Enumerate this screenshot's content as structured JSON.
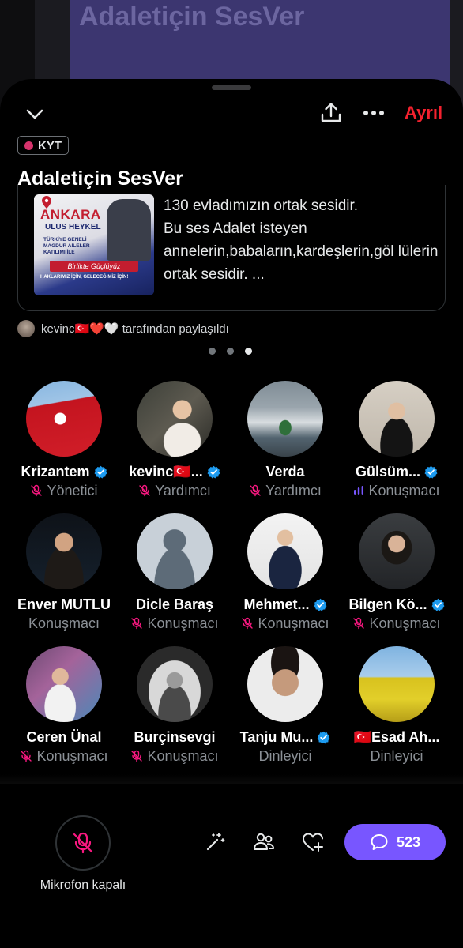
{
  "background": {
    "title": "Adaletiçin SesVer"
  },
  "header": {
    "leave_label": "Ayrıl",
    "badge": "KYT",
    "title": "Adaletiçin SesVer"
  },
  "pinned_post": {
    "text": "130 evladımızın ortak sesidir.\nBu ses Adalet isteyen annelerin,babaların,kardeşlerin,göl lülerin ortak sesidir. ...",
    "poster": {
      "city": "ANKARA",
      "place": "ULUS HEYKEL",
      "line": "TÜRKİYE GENELİ MAĞDUR AİLELER KATILIMI İLE",
      "slogan": "Birlikte Güçlüyüz",
      "footer": "HAKLARIMIZ İÇİN, GELECEĞİMİZ İÇİN!"
    },
    "shared_by": "kevinc🇹🇷❤️🤍 tarafından paylaşıldı"
  },
  "pager": {
    "count": 3,
    "active": 2
  },
  "participants": [
    {
      "name": "Krizantem",
      "verified": true,
      "role": "Yönetici",
      "status": "muted",
      "avatar": "flag"
    },
    {
      "name": "kevinc🇹🇷...",
      "verified": true,
      "role": "Yardımcı",
      "status": "muted",
      "avatar": "photo-woman"
    },
    {
      "name": "Verda",
      "verified": false,
      "role": "Yardımcı",
      "status": "muted",
      "avatar": "photo-sea"
    },
    {
      "name": "Gülsüm...",
      "verified": true,
      "role": "Konuşmacı",
      "status": "speaking",
      "avatar": "photo-girl"
    },
    {
      "name": "Enver MUTLU",
      "verified": false,
      "role": "Konuşmacı",
      "status": "none",
      "avatar": "photo-man"
    },
    {
      "name": "Dicle Baraş",
      "verified": false,
      "role": "Konuşmacı",
      "status": "muted",
      "avatar": "default"
    },
    {
      "name": "Mehmet...",
      "verified": true,
      "role": "Konuşmacı",
      "status": "muted",
      "avatar": "photo-suit"
    },
    {
      "name": "Bilgen Kö...",
      "verified": true,
      "role": "Konuşmacı",
      "status": "muted",
      "avatar": "photo-woman2"
    },
    {
      "name": "Ceren Ünal",
      "verified": false,
      "role": "Konuşmacı",
      "status": "muted",
      "avatar": "photo-girl2"
    },
    {
      "name": "Burçinsevgi",
      "verified": false,
      "role": "Konuşmacı",
      "status": "muted",
      "avatar": "photo-bw"
    },
    {
      "name": "Tanju Mu...",
      "verified": true,
      "role": "Dinleyici",
      "status": "none",
      "avatar": "photo-young"
    },
    {
      "name": "🇹🇷Esad Ah...",
      "verified": false,
      "role": "Dinleyici",
      "status": "none",
      "avatar": "photo-field"
    }
  ],
  "footer": {
    "mic_label": "Mikrofon kapalı",
    "comment_count": "523"
  },
  "colors": {
    "accent": "#7856ff",
    "leave": "#f4212e",
    "muted_icon": "#f91880",
    "verified": "#1d9bf0"
  }
}
